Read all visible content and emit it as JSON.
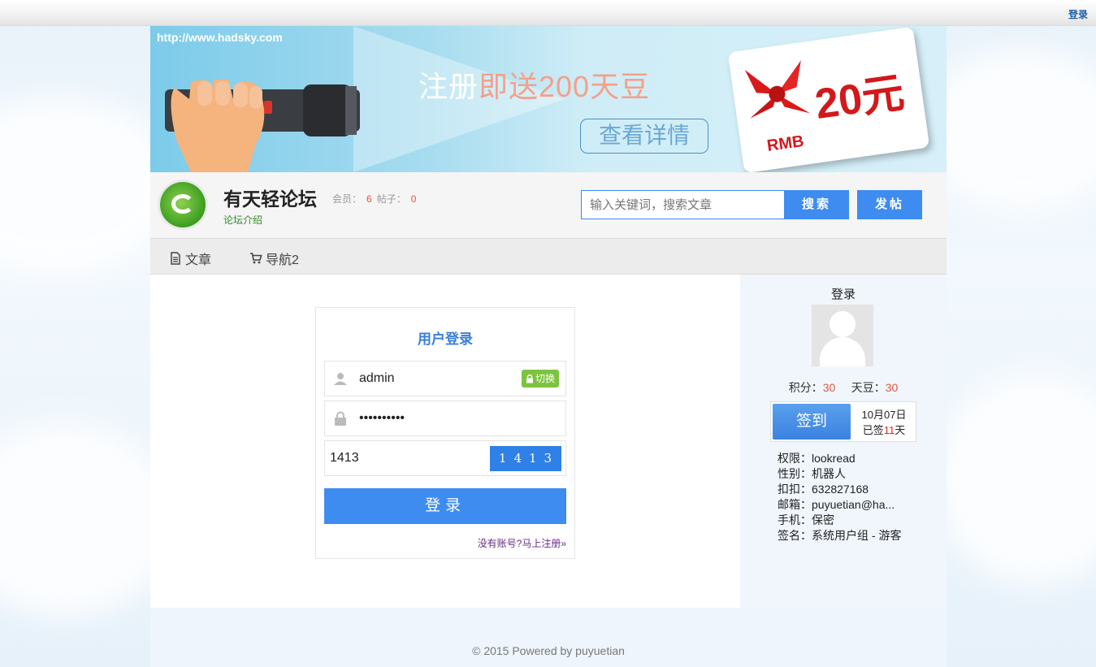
{
  "topbar": {
    "login_label": "登录"
  },
  "banner": {
    "url": "http://www.hadsky.com",
    "promo_prefix": "注册",
    "promo_text": "即送200天豆",
    "detail_button": "查看详情",
    "card_amount": "20元",
    "card_currency": "RMB"
  },
  "header": {
    "title": "有天轻论坛",
    "members_label": "会员：",
    "members_count": "6",
    "posts_label": "帖子：",
    "posts_count": "0",
    "intro_link": "论坛介绍",
    "search_placeholder": "输入关键词，搜索文章",
    "search_button": "搜索",
    "post_button": "发帖"
  },
  "nav": {
    "items": [
      {
        "label": "文章",
        "icon": "document-icon"
      },
      {
        "label": "导航2",
        "icon": "cart-icon"
      }
    ]
  },
  "login_form": {
    "title": "用户登录",
    "username": "admin",
    "switch_label": "切换",
    "password_masked": "••••••••••",
    "captcha_input": "1413",
    "captcha_image_text": "1413",
    "submit_label": "登录",
    "register_link": "没有账号?马上注册»"
  },
  "sidebar": {
    "title": "登录",
    "points_label": "积分：",
    "points_value": "30",
    "beans_label": "天豆：",
    "beans_value": "30",
    "sign_button": "签到",
    "sign_date": "10月07日",
    "sign_days_prefix": "已签",
    "sign_days": "11",
    "sign_days_suffix": "天",
    "info": [
      "权限：lookread",
      "性别：机器人",
      "扣扣：632827168",
      "邮箱：puyuetian@ha...",
      "手机：保密",
      "签名：系统用户组 - 游客"
    ]
  },
  "footer": {
    "copyright": "© 2015 Powered by puyuetian"
  },
  "colors": {
    "accent": "#3e8cf0",
    "green": "#7cc33f",
    "highlight": "#e8553b"
  }
}
